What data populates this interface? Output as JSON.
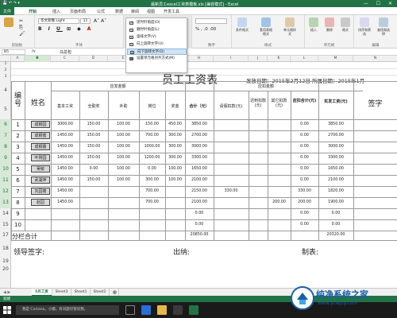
{
  "app": {
    "title": "最新员工excel工资表模板.xls [兼容模式] - Excel",
    "window_buttons": "— ☐ ✕"
  },
  "menu": {
    "tabs": [
      "文件",
      "开始",
      "插入",
      "页面布局",
      "公式",
      "数据",
      "审阅",
      "视图",
      "开发工具"
    ]
  },
  "ribbon": {
    "font_name": "华文新魏 Light",
    "font_size": "11",
    "wrap_label": "自动换行",
    "groups": {
      "clipboard": "剪贴板",
      "font": "字体",
      "alignment": "对齐方式",
      "number": "数字",
      "styles": "样式",
      "cells": "单元格",
      "editing": "编辑"
    },
    "buttons": [
      "条件格式",
      "套用表格格式",
      "单元格样式",
      "插入",
      "删除",
      "格式",
      "排序和筛选",
      "查找和选择"
    ]
  },
  "orientation_menu": {
    "items": [
      "逆时针角度(O)",
      "顺时针角度(L)",
      "竖排文字(V)",
      "向上旋转文字(U)",
      "向下旋转文字(D)",
      "设置单元格对齐方式(M)"
    ],
    "active_index": 4
  },
  "formula_bar": {
    "name_box": "B5",
    "fx": "fx",
    "content": "马总包"
  },
  "columns": [
    "A",
    "B",
    "C",
    "D",
    "E",
    "F",
    "G",
    "H",
    "I",
    "J",
    "K",
    "L",
    "M",
    "N"
  ],
  "rows": [
    "1",
    "2",
    "3",
    "4",
    "5",
    "6",
    "7",
    "8",
    "9",
    "10",
    "11",
    "12",
    "13",
    "14",
    "15",
    "16",
    "17",
    "18",
    "19",
    "20"
  ],
  "sheet": {
    "title": "员工工资表",
    "dates": "发放日期：2015年2月12日 所属日期：2015年1月",
    "headers": {
      "num": "编号",
      "name": "姓名",
      "payable": "应发金额",
      "deduct": "应扣金额",
      "sub_payable": [
        "基本工资",
        "全勤奖",
        "补助",
        "岗位",
        "奖金",
        "合计（元）"
      ],
      "sub_deduct": [
        "请假扣款(元)",
        "迟到扣款(元)",
        "其它扣款(元)",
        "应扣合计(元)"
      ],
      "net": "实发工资(元)",
      "sign": "签字"
    },
    "employees": [
      {
        "no": "1",
        "name": "成钢园",
        "base": "3000.00",
        "attend": "150.00",
        "subsidy": "100.00",
        "post": "150.00",
        "bonus": "450.00",
        "total": "3850.00",
        "leave": "",
        "late": "",
        "other": "",
        "deduct": "0.00",
        "net": "3850.00"
      },
      {
        "no": "2",
        "name": "成钢蜜",
        "base": "1450.00",
        "attend": "150.00",
        "subsidy": "100.00",
        "post": "700.00",
        "bonus": "300.00",
        "total": "2700.00",
        "leave": "",
        "late": "",
        "other": "",
        "deduct": "0.00",
        "net": "2700.00"
      },
      {
        "no": "3",
        "name": "成钢蕾",
        "base": "1450.00",
        "attend": "150.00",
        "subsidy": "100.00",
        "post": "1000.00",
        "bonus": "300.00",
        "total": "3000.00",
        "leave": "",
        "late": "",
        "other": "",
        "deduct": "0.00",
        "net": "3000.00"
      },
      {
        "no": "4",
        "name": "叶刚园",
        "base": "1450.00",
        "attend": "150.00",
        "subsidy": "100.00",
        "post": "1200.00",
        "bonus": "300.00",
        "total": "3300.00",
        "leave": "",
        "late": "",
        "other": "",
        "deduct": "0.00",
        "net": "3300.00"
      },
      {
        "no": "5",
        "name": "吴敏",
        "base": "1450.00",
        "attend": "0.00",
        "subsidy": "100.00",
        "post": "0.00",
        "bonus": "100.00",
        "total": "1650.00",
        "leave": "",
        "late": "",
        "other": "",
        "deduct": "0.00",
        "net": "1650.00"
      },
      {
        "no": "6",
        "name": "武湖萍",
        "base": "1450.00",
        "attend": "150.00",
        "subsidy": "100.00",
        "post": "300.00",
        "bonus": "100.00",
        "total": "2100.00",
        "leave": "",
        "late": "",
        "other": "",
        "deduct": "0.00",
        "net": "2100.00"
      },
      {
        "no": "7",
        "name": "刘园筱",
        "base": "1450.00",
        "attend": "",
        "subsidy": "",
        "post": "700.00",
        "bonus": "",
        "total": "2150.00",
        "leave": "330.00",
        "late": "",
        "other": "",
        "deduct": "330.00",
        "net": "1820.00"
      },
      {
        "no": "8",
        "name": "赵园",
        "base": "1450.00",
        "attend": "",
        "subsidy": "",
        "post": "700.00",
        "bonus": "",
        "total": "2100.00",
        "leave": "",
        "late": "",
        "other": "200.00",
        "deduct": "200.00",
        "net": "1900.00"
      },
      {
        "no": "9",
        "name": "",
        "base": "",
        "attend": "",
        "subsidy": "",
        "post": "",
        "bonus": "",
        "total": "0.00",
        "leave": "",
        "late": "",
        "other": "",
        "deduct": "0.00",
        "net": "0.00"
      },
      {
        "no": "10",
        "name": "",
        "base": "",
        "attend": "",
        "subsidy": "",
        "post": "",
        "bonus": "",
        "total": "0.00",
        "leave": "",
        "late": "",
        "other": "",
        "deduct": "0.00",
        "net": "0.00"
      }
    ],
    "summary_label": "分栏合计",
    "summary_total": "20850.00",
    "summary_net": "20320.00",
    "sign_leader": "领导签字:",
    "sign_cashier": "出纳:",
    "sign_maker": "制表:"
  },
  "sheet_tabs": [
    "5月工资",
    "Sheet3",
    "Sheet1",
    "Sheet2"
  ],
  "status": {
    "ready": "就绪"
  },
  "taskbar": {
    "search": "我是 Cortana，小娜。有问题尽管问我。"
  },
  "watermark": {
    "text": "纯净系统之家",
    "url": "www.ycwjzy.com"
  },
  "colors": {
    "excel_green": "#217346",
    "watermark_blue": "#1a5fa8"
  }
}
